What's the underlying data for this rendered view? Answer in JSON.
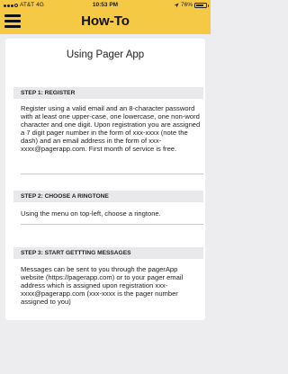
{
  "status_bar": {
    "carrier": "AT&T",
    "network": "4G",
    "time": "10:53 PM",
    "battery_percent": "76%",
    "battery_level": 0.76
  },
  "nav": {
    "menu_icon": "hamburger-menu-icon",
    "title": "How-To"
  },
  "content": {
    "title": "Using Pager App",
    "sections": [
      {
        "header": "STEP 1: REGISTER",
        "body": "Register using a valid email and an 8-character password with at least one upper-case, one lowercase, one non-word character and one digit. Upon registration you are assigned a 7 digit pager number in the form of xxx-xxxx (note the dash) and an email address in the form of xxx-xxxx@pagerapp.com. First month of service is free."
      },
      {
        "header": "STEP 2: CHOOSE A RINGTONE",
        "body": "Using the menu on top-left, choose a ringtone."
      },
      {
        "header": "STEP 3: START GETTTING MESSAGES",
        "body": "Messages can be sent to you through the pagerApp website (https://pagerapp.com) or to your pager email address which is assigned upon registration xxx-xxxx@pagerapp.com (xxx-xxxx is the pager number assigned to you)"
      }
    ]
  },
  "colors": {
    "header_bar": "#f6c945",
    "background": "#ededf0",
    "card": "#ffffff",
    "section_header_bg": "#e9e9ec"
  }
}
